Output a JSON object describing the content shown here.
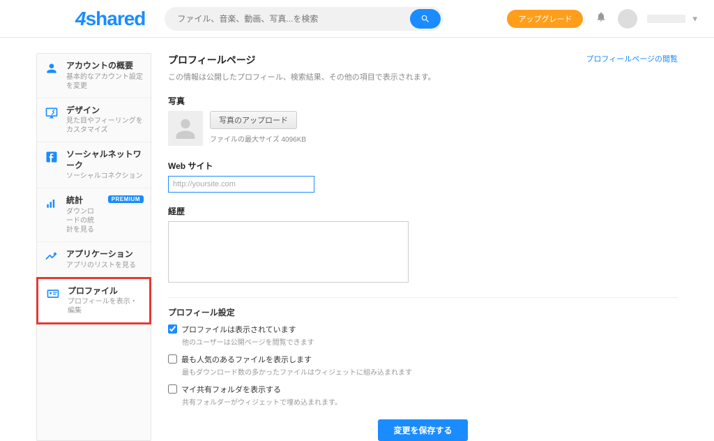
{
  "brand": {
    "four": "4",
    "shared": "shared"
  },
  "search": {
    "placeholder": "ファイル、音楽、動画、写真...を検索"
  },
  "header": {
    "upgrade_label": "アップグレード"
  },
  "sidebar": {
    "items": [
      {
        "title": "アカウントの概要",
        "sub": "基本的なアカウント設定を変更"
      },
      {
        "title": "デザイン",
        "sub": "見た目やフィーリングをカスタマイズ"
      },
      {
        "title": "ソーシャルネットワーク",
        "sub": "ソーシャルコネクション"
      },
      {
        "title": "統計",
        "sub": "ダウンロードの統計を見る",
        "badge": "PREMIUM"
      },
      {
        "title": "アプリケーション",
        "sub": "アプリのリストを見る"
      },
      {
        "title": "プロファイル",
        "sub": "プロフィールを表示・編集"
      }
    ]
  },
  "main": {
    "title": "プロフィールページ",
    "desc": "この情報は公開したプロフィール、検索結果、その他の項目で表示されます。",
    "view_link": "プロフィールページの閲覧",
    "photo_label": "写真",
    "upload_label": "写真のアップロード",
    "max_size": "ファイルの最大サイズ 4096KB",
    "website_label": "Web サイト",
    "website_placeholder": "http://yoursite.com",
    "bio_label": "経歴",
    "settings_title": "プロフィール設定",
    "settings": [
      {
        "label": "プロファイルは表示されています",
        "note": "他のユーザーは公開ページを閲覧できます",
        "checked": true
      },
      {
        "label": "最も人気のあるファイルを表示します",
        "note": "最もダウンロード数の多かったファイルはウィジェットに組み込まれます",
        "checked": false
      },
      {
        "label": "マイ共有フォルダを表示する",
        "note": "共有フォルダーがウィジェットで埋め込まれます。",
        "checked": false
      }
    ],
    "save_label": "変更を保存する"
  }
}
